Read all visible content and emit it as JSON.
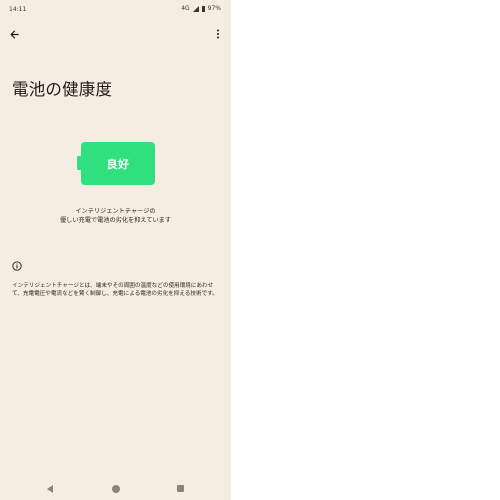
{
  "status_bar": {
    "time": "14:11",
    "network": "4G",
    "battery": "97%"
  },
  "app_bar": {
    "back_icon": "arrow-left-icon",
    "menu_icon": "more-vert-icon"
  },
  "page": {
    "title": "電池の健康度"
  },
  "battery": {
    "label": "良好",
    "color": "#2ee07e"
  },
  "status": {
    "line1": "インテリジェントチャージの",
    "line2": "優しい充電で電池の劣化を抑えています"
  },
  "info": {
    "icon": "info-icon",
    "text": "インテリジェントチャージとは、端末やその周囲の温度などの使用環境にあわせて、充電電圧や電流などを賢く制御し、充電による電池の劣化を抑える技術です。"
  },
  "nav_bar": {
    "back": "nav-back-icon",
    "home": "nav-home-icon",
    "recents": "nav-recents-icon"
  }
}
